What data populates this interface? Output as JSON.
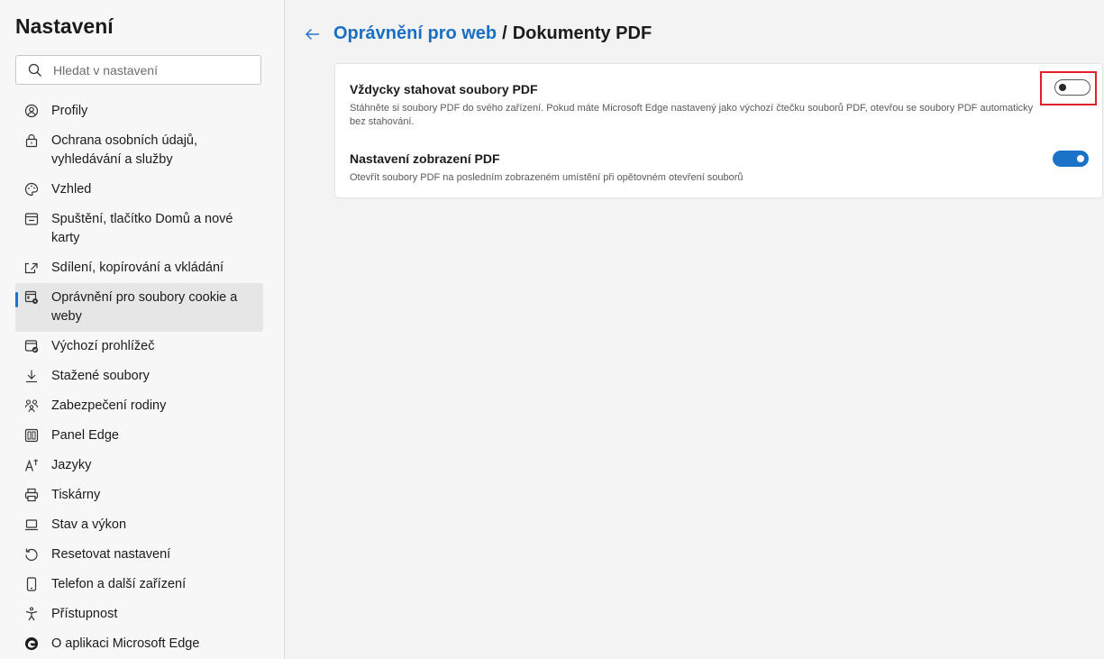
{
  "sidebar": {
    "title": "Nastavení",
    "search_placeholder": "Hledat v nastavení",
    "items": [
      {
        "label": "Profily",
        "icon": "profile-icon",
        "active": false
      },
      {
        "label": "Ochrana osobních údajů, vyhledávání a služby",
        "icon": "lock-icon",
        "active": false
      },
      {
        "label": "Vzhled",
        "icon": "palette-icon",
        "active": false
      },
      {
        "label": "Spuštění, tlačítko Domů a nové karty",
        "icon": "home-window-icon",
        "active": false
      },
      {
        "label": "Sdílení, kopírování a vkládání",
        "icon": "share-icon",
        "active": false
      },
      {
        "label": "Oprávnění pro soubory cookie a weby",
        "icon": "cookie-settings-icon",
        "active": true
      },
      {
        "label": "Výchozí prohlížeč",
        "icon": "default-browser-icon",
        "active": false
      },
      {
        "label": "Stažené soubory",
        "icon": "download-icon",
        "active": false
      },
      {
        "label": "Zabezpečení rodiny",
        "icon": "family-icon",
        "active": false
      },
      {
        "label": "Panel Edge",
        "icon": "edge-bar-icon",
        "active": false
      },
      {
        "label": "Jazyky",
        "icon": "languages-icon",
        "active": false
      },
      {
        "label": "Tiskárny",
        "icon": "printer-icon",
        "active": false
      },
      {
        "label": "Stav a výkon",
        "icon": "laptop-icon",
        "active": false
      },
      {
        "label": "Resetovat nastavení",
        "icon": "reset-icon",
        "active": false
      },
      {
        "label": "Telefon a další zařízení",
        "icon": "phone-icon",
        "active": false
      },
      {
        "label": "Přístupnost",
        "icon": "accessibility-icon",
        "active": false
      },
      {
        "label": "O aplikaci Microsoft Edge",
        "icon": "edge-logo-icon",
        "active": false
      }
    ]
  },
  "breadcrumb": {
    "parent": "Oprávnění pro web",
    "separator": "/",
    "current": "Dokumenty PDF"
  },
  "settings": [
    {
      "title": "Vždycky stahovat soubory PDF",
      "description": "Stáhněte si soubory PDF do svého zařízení. Pokud máte Microsoft Edge nastavený jako výchozí čtečku souborů PDF, otevřou se soubory PDF automaticky bez stahování.",
      "enabled": false
    },
    {
      "title": "Nastavení zobrazení PDF",
      "description": "Otevřít soubory PDF na posledním zobrazeném umístění při opětovném otevření souborů",
      "enabled": true
    }
  ],
  "colors": {
    "accent": "#1a73c9",
    "highlight": "#e0202a"
  }
}
